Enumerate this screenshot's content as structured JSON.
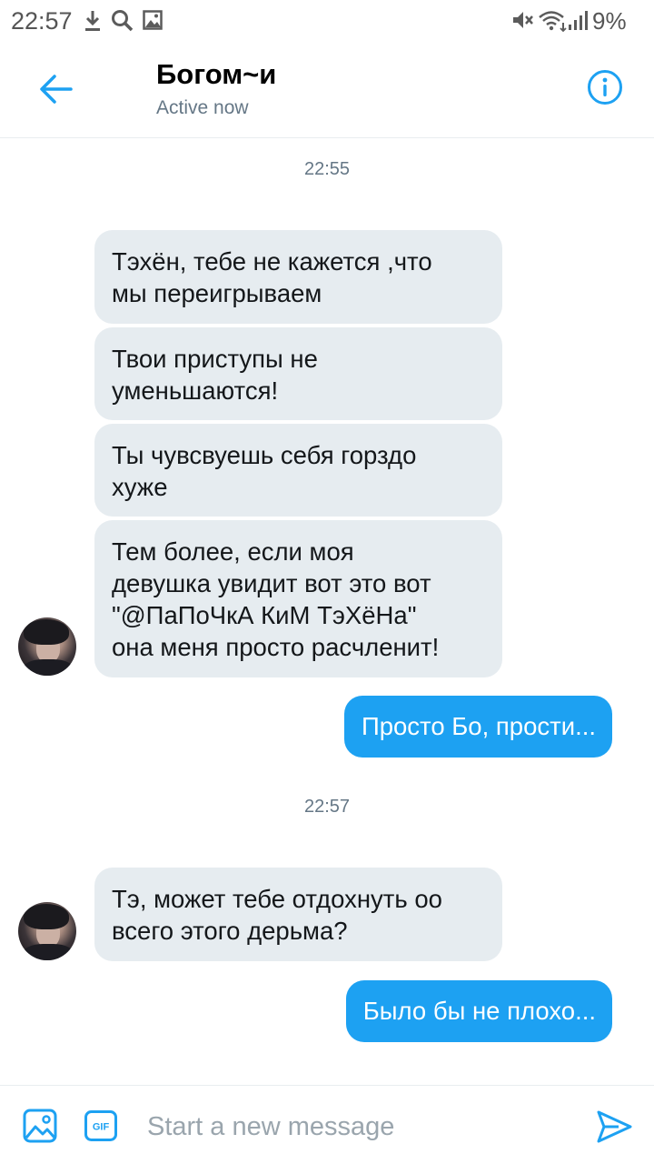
{
  "status_bar": {
    "time": "22:57",
    "battery": "9%",
    "icons": [
      "download-icon",
      "search-icon",
      "image-icon",
      "mute-icon",
      "wifi-icon",
      "signal-icon"
    ]
  },
  "header": {
    "name": "Богом~и",
    "status": "Active now",
    "icons": [
      "back-arrow-icon",
      "info-icon"
    ]
  },
  "messages": {
    "timestamps": [
      "22:55",
      "22:57"
    ],
    "incoming": [
      [
        "Тэхён, тебе не кажется ,что",
        "мы переигрываем"
      ],
      [
        "Твои приступы не",
        "уменьшаются!"
      ],
      [
        "Ты чувсвуешь себя горздо",
        "хуже"
      ],
      [
        "Тем более, если моя",
        "девушка увидит вот это вот",
        "\"@ПаПоЧкА КиМ ТэХёНа\"",
        "она меня просто расчленит!"
      ],
      [
        "Тэ, может тебе отдохнуть оо",
        "всего этого дерьма?"
      ]
    ],
    "outgoing": [
      "Просто Бо, прости...",
      "Было бы не плохо..."
    ]
  },
  "compose": {
    "placeholder": "Start a new message",
    "gif_label": "GIF",
    "icons": [
      "photo-icon",
      "gif-icon",
      "send-icon"
    ]
  },
  "colors": {
    "accent": "#1da1f2",
    "incoming_bubble": "#e6ecf0",
    "secondary_text": "#657786"
  }
}
